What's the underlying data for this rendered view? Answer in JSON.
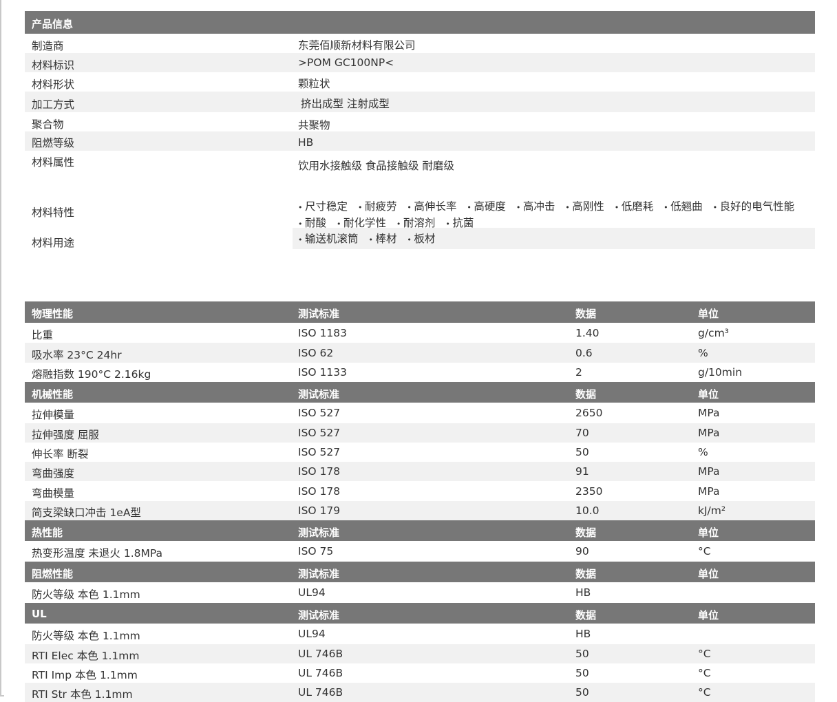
{
  "product_info": {
    "header": "产品信息",
    "rows": [
      {
        "label": "制造商",
        "value": "东莞佰顺新材料有限公司"
      },
      {
        "label": "材料标识",
        "value": ">POM GC100NP<"
      },
      {
        "label": "材料形状",
        "value": "颗粒状"
      },
      {
        "label": "加工方式",
        "value": "挤出成型 注射成型"
      },
      {
        "label": "聚合物",
        "value": "共聚物"
      },
      {
        "label": "阻燃等级",
        "value": "HB"
      },
      {
        "label": "材料属性",
        "value": "饮用水接触级 食品接触级 耐磨级"
      }
    ],
    "features_label": "材料特性",
    "features": [
      "尺寸稳定",
      "耐疲劳",
      "高伸长率",
      "高硬度",
      "高冲击",
      "高刚性",
      "低磨耗",
      "低翘曲",
      "良好的电气性能",
      "耐酸",
      "耐化学性",
      "耐溶剂",
      "抗菌"
    ],
    "uses_label": "材料用途",
    "uses": [
      "输送机滚筒",
      "棒材",
      "板材"
    ]
  },
  "columns": {
    "standard": "测试标准",
    "data": "数据",
    "unit": "单位"
  },
  "sections": [
    {
      "title": "物理性能",
      "rows": [
        {
          "name": "比重",
          "standard": "ISO 1183",
          "value": "1.40",
          "unit": "g/cm³"
        },
        {
          "name": "吸水率   23°C 24hr",
          "standard": "ISO 62",
          "value": "0.6",
          "unit": "%"
        },
        {
          "name": "熔融指数   190°C 2.16kg",
          "standard": "ISO 1133",
          "value": "2",
          "unit": "g/10min"
        }
      ]
    },
    {
      "title": "机械性能",
      "rows": [
        {
          "name": "拉伸模量",
          "standard": "ISO 527",
          "value": "2650",
          "unit": "MPa"
        },
        {
          "name": "拉伸强度   屈服",
          "standard": "ISO 527",
          "value": "70",
          "unit": "MPa"
        },
        {
          "name": "伸长率   断裂",
          "standard": "ISO 527",
          "value": "50",
          "unit": "%"
        },
        {
          "name": "弯曲强度",
          "standard": "ISO 178",
          "value": "91",
          "unit": "MPa"
        },
        {
          "name": "弯曲模量",
          "standard": "ISO 178",
          "value": "2350",
          "unit": "MPa"
        },
        {
          "name": "简支梁缺口冲击   1eA型",
          "standard": "ISO 179",
          "value": "10.0",
          "unit": "kJ/m²"
        }
      ]
    },
    {
      "title": "热性能",
      "rows": [
        {
          "name": "热变形温度   未退火 1.8MPa",
          "standard": "ISO 75",
          "value": "90",
          "unit": "°C"
        }
      ]
    },
    {
      "title": "阻燃性能",
      "rows": [
        {
          "name": "防火等级   本色 1.1mm",
          "standard": "UL94",
          "value": "HB",
          "unit": ""
        }
      ]
    },
    {
      "title": "UL",
      "rows": [
        {
          "name": "防火等级   本色 1.1mm",
          "standard": "UL94",
          "value": "HB",
          "unit": ""
        },
        {
          "name": "RTI Elec   本色 1.1mm",
          "standard": "UL 746B",
          "value": "50",
          "unit": "°C"
        },
        {
          "name": "RTI Imp   本色 1.1mm",
          "standard": "UL 746B",
          "value": "50",
          "unit": "°C"
        },
        {
          "name": "RTI Str   本色 1.1mm",
          "standard": "UL 746B",
          "value": "50",
          "unit": "°C"
        }
      ]
    }
  ],
  "colors": {
    "header_bg": "#777777",
    "header_text": "#ffffff",
    "alt_row_bg": "#f1f1f1",
    "text": "#333333"
  }
}
